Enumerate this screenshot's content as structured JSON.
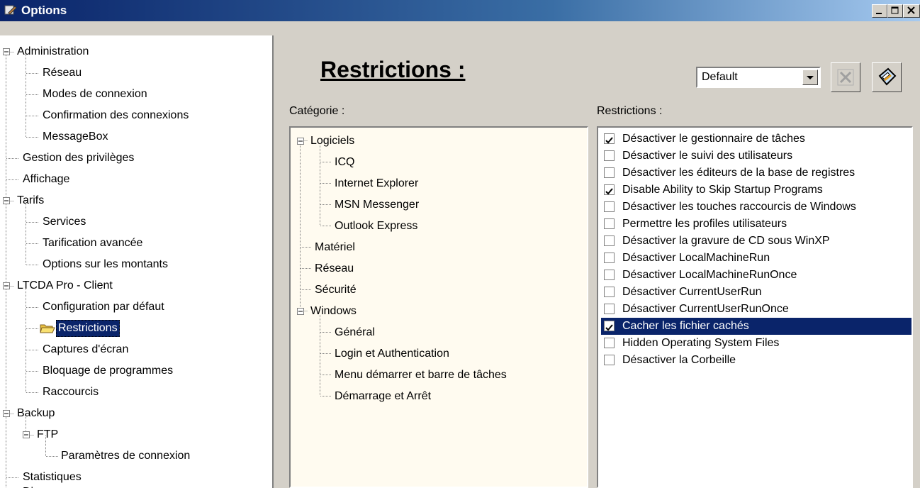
{
  "window": {
    "title": "Options"
  },
  "left_tree": {
    "items": [
      {
        "label": "Administration"
      },
      {
        "label": "Réseau"
      },
      {
        "label": "Modes de connexion"
      },
      {
        "label": "Confirmation des connexions"
      },
      {
        "label": "MessageBox"
      },
      {
        "label": "Gestion des privilèges"
      },
      {
        "label": "Affichage"
      },
      {
        "label": "Tarifs"
      },
      {
        "label": "Services"
      },
      {
        "label": "Tarification avancée"
      },
      {
        "label": "Options sur les montants"
      },
      {
        "label": "LTCDA Pro - Client"
      },
      {
        "label": "Configuration par défaut"
      },
      {
        "label": "Restrictions"
      },
      {
        "label": "Captures d'écran"
      },
      {
        "label": "Bloquage de programmes"
      },
      {
        "label": "Raccourcis"
      },
      {
        "label": "Backup"
      },
      {
        "label": "FTP"
      },
      {
        "label": "Paramètres de connexion"
      },
      {
        "label": "Statistiques"
      },
      {
        "label": "Divers"
      }
    ]
  },
  "main": {
    "heading": "Restrictions :",
    "profile_select": "Default",
    "category_label": "Catégorie :",
    "restrictions_label": "Restrictions :"
  },
  "categories": {
    "items": [
      {
        "label": "Logiciels"
      },
      {
        "label": "ICQ"
      },
      {
        "label": "Internet Explorer"
      },
      {
        "label": "MSN Messenger"
      },
      {
        "label": "Outlook Express"
      },
      {
        "label": "Matériel"
      },
      {
        "label": "Réseau"
      },
      {
        "label": "Sécurité"
      },
      {
        "label": "Windows"
      },
      {
        "label": "Général"
      },
      {
        "label": "Login et Authentication"
      },
      {
        "label": "Menu démarrer et barre de tâches"
      },
      {
        "label": "Démarrage et Arrêt"
      }
    ]
  },
  "restrictions": {
    "items": [
      {
        "label": "Désactiver le gestionnaire de tâches",
        "checked": true
      },
      {
        "label": "Désactiver le suivi des utilisateurs",
        "checked": false
      },
      {
        "label": "Désactiver les éditeurs de la base de registres",
        "checked": false
      },
      {
        "label": "Disable Ability to Skip Startup Programs",
        "checked": true
      },
      {
        "label": "Désactiver les touches raccourcis de Windows",
        "checked": false
      },
      {
        "label": "Permettre les profiles utilisateurs",
        "checked": false
      },
      {
        "label": "Désactiver la gravure de CD sous WinXP",
        "checked": false
      },
      {
        "label": "Désactiver LocalMachineRun",
        "checked": false
      },
      {
        "label": "Désactiver LocalMachineRunOnce",
        "checked": false
      },
      {
        "label": "Désactiver CurrentUserRun",
        "checked": false
      },
      {
        "label": "Désactiver CurrentUserRunOnce",
        "checked": false
      },
      {
        "label": "Cacher les fichier cachés",
        "checked": true,
        "selected": true
      },
      {
        "label": "Hidden Operating System Files",
        "checked": false
      },
      {
        "label": "Désactiver la Corbeille",
        "checked": false
      }
    ]
  }
}
